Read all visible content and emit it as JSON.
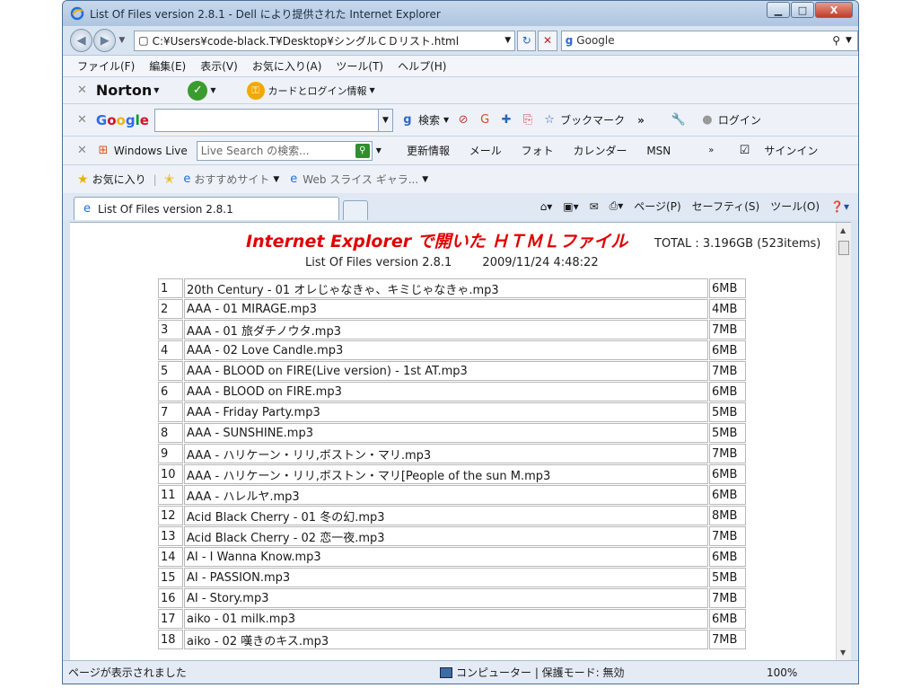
{
  "window": {
    "title": "List Of Files version 2.8.1 - Dell により提供された Internet Explorer",
    "minimize": "▁",
    "maximize": "□",
    "close": "X"
  },
  "address": {
    "url": "C:¥Users¥code-black.T¥Desktop¥シングルＣＤリスト.html",
    "search_engine": "Google"
  },
  "menu": [
    "ファイル(F)",
    "編集(E)",
    "表示(V)",
    "お気に入り(A)",
    "ツール(T)",
    "ヘルプ(H)"
  ],
  "norton": {
    "brand": "Norton",
    "login_info": "カードとログイン情報"
  },
  "google_toolbar": {
    "logo": "Google",
    "search_label": "検索",
    "bookmarks": "ブックマーク",
    "login": "ログイン"
  },
  "live_toolbar": {
    "brand": "Windows Live",
    "search_placeholder": "Live Search の検索...",
    "links": [
      "更新情報",
      "メール",
      "フォト",
      "カレンダー",
      "MSN"
    ],
    "signin": "サインイン"
  },
  "favorites": {
    "label": "お気に入り",
    "suggested": "おすすめサイト",
    "web_slice": "Web スライス ギャラ..."
  },
  "tab": {
    "title": "List Of Files version 2.8.1"
  },
  "command_bar": {
    "page": "ページ(P)",
    "safety": "セーフティ(S)",
    "tools": "ツール(O)"
  },
  "page": {
    "heading": "Internet Explorer で開いた ＨＴＭＬファイル",
    "total": "TOTAL : 3.196GB (523items)",
    "app_version": "List Of Files version 2.8.1",
    "datetime": "2009/11/24 4:48:22",
    "rows": [
      {
        "n": "1",
        "name": "20th Century - 01 オレじゃなきゃ、キミじゃなきゃ.mp3",
        "size": "6MB"
      },
      {
        "n": "2",
        "name": "AAA - 01 MIRAGE.mp3",
        "size": "4MB"
      },
      {
        "n": "3",
        "name": "AAA - 01 旅ダチノウタ.mp3",
        "size": "7MB"
      },
      {
        "n": "4",
        "name": "AAA - 02 Love Candle.mp3",
        "size": "6MB"
      },
      {
        "n": "5",
        "name": "AAA - BLOOD on FIRE(Live version) - 1st AT.mp3",
        "size": "7MB"
      },
      {
        "n": "6",
        "name": "AAA - BLOOD on FIRE.mp3",
        "size": "6MB"
      },
      {
        "n": "7",
        "name": "AAA - Friday Party.mp3",
        "size": "5MB"
      },
      {
        "n": "8",
        "name": "AAA - SUNSHINE.mp3",
        "size": "5MB"
      },
      {
        "n": "9",
        "name": "AAA - ハリケーン・リリ,ボストン・マリ.mp3",
        "size": "7MB"
      },
      {
        "n": "10",
        "name": "AAA - ハリケーン・リリ,ボストン・マリ[People of the sun M.mp3",
        "size": "6MB"
      },
      {
        "n": "11",
        "name": "AAA - ハレルヤ.mp3",
        "size": "6MB"
      },
      {
        "n": "12",
        "name": "Acid Black Cherry - 01 冬の幻.mp3",
        "size": "8MB"
      },
      {
        "n": "13",
        "name": "Acid Black Cherry - 02 恋一夜.mp3",
        "size": "7MB"
      },
      {
        "n": "14",
        "name": "AI - I Wanna Know.mp3",
        "size": "6MB"
      },
      {
        "n": "15",
        "name": "AI - PASSION.mp3",
        "size": "5MB"
      },
      {
        "n": "16",
        "name": "AI - Story.mp3",
        "size": "7MB"
      },
      {
        "n": "17",
        "name": "aiko - 01 milk.mp3",
        "size": "6MB"
      },
      {
        "n": "18",
        "name": "aiko - 02 嘆きのキス.mp3",
        "size": "7MB"
      }
    ]
  },
  "status": {
    "message": "ページが表示されました",
    "zone": "コンピューター | 保護モード: 無効",
    "zoom": "100%"
  }
}
